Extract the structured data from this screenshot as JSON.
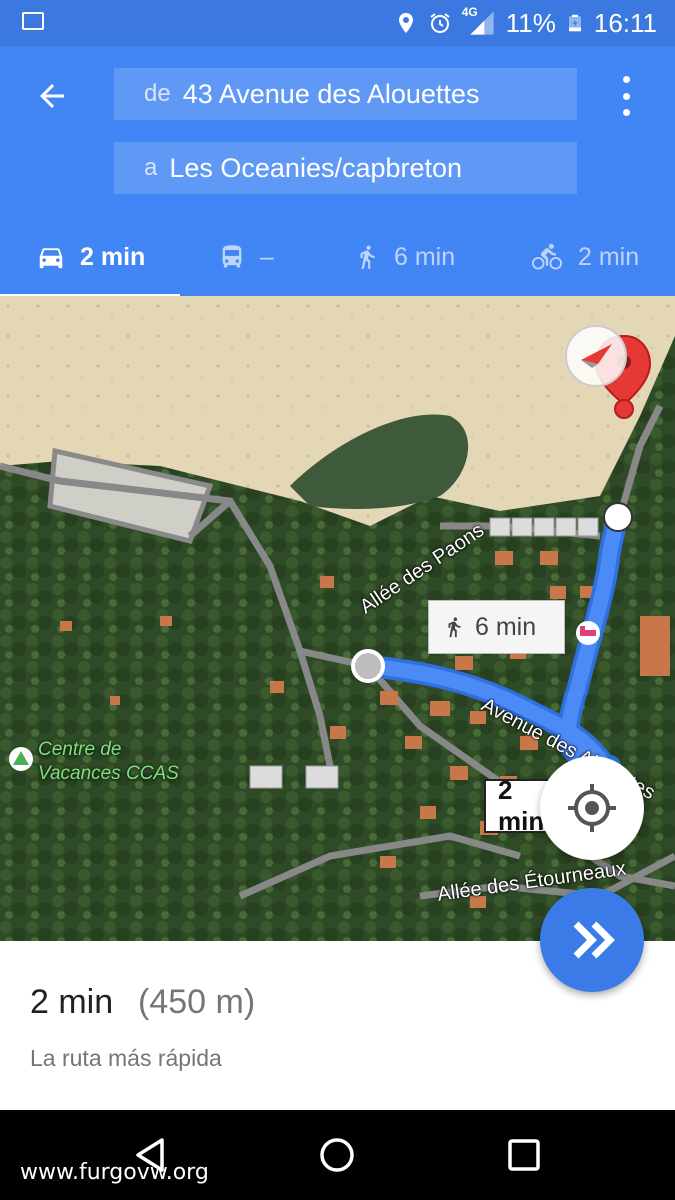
{
  "status_bar": {
    "network": "4G",
    "battery": "11%",
    "time": "16:11",
    "icons": [
      "image-icon",
      "location-icon",
      "alarm-icon",
      "signal-icon",
      "battery-icon"
    ]
  },
  "header": {
    "from_prefix": "de",
    "from_value": "43 Avenue des Alouettes",
    "to_prefix": "a",
    "to_value": "Les Oceanies/capbreton",
    "tabs": [
      {
        "icon": "car-icon",
        "label": "2 min",
        "active": true
      },
      {
        "icon": "transit-icon",
        "label": "–",
        "active": false
      },
      {
        "icon": "walk-icon",
        "label": "6 min",
        "active": false
      },
      {
        "icon": "bike-icon",
        "label": "2 min",
        "active": false
      }
    ],
    "colors": {
      "primary": "#4285f4",
      "status": "#3b79e0"
    }
  },
  "map": {
    "street_labels": [
      "Allée des Paons",
      "Avenue des Alouettes",
      "Allée des Étourneaux"
    ],
    "poi_label": "Centre de Vacances CCAS",
    "walk_bubble": "6 min",
    "route_label": "2 min",
    "route_color": "#4c8bf5"
  },
  "summary": {
    "time": "2 min",
    "distance": "(450 m)",
    "description": "La ruta más rápida"
  },
  "watermark": "www.furgovw.org"
}
